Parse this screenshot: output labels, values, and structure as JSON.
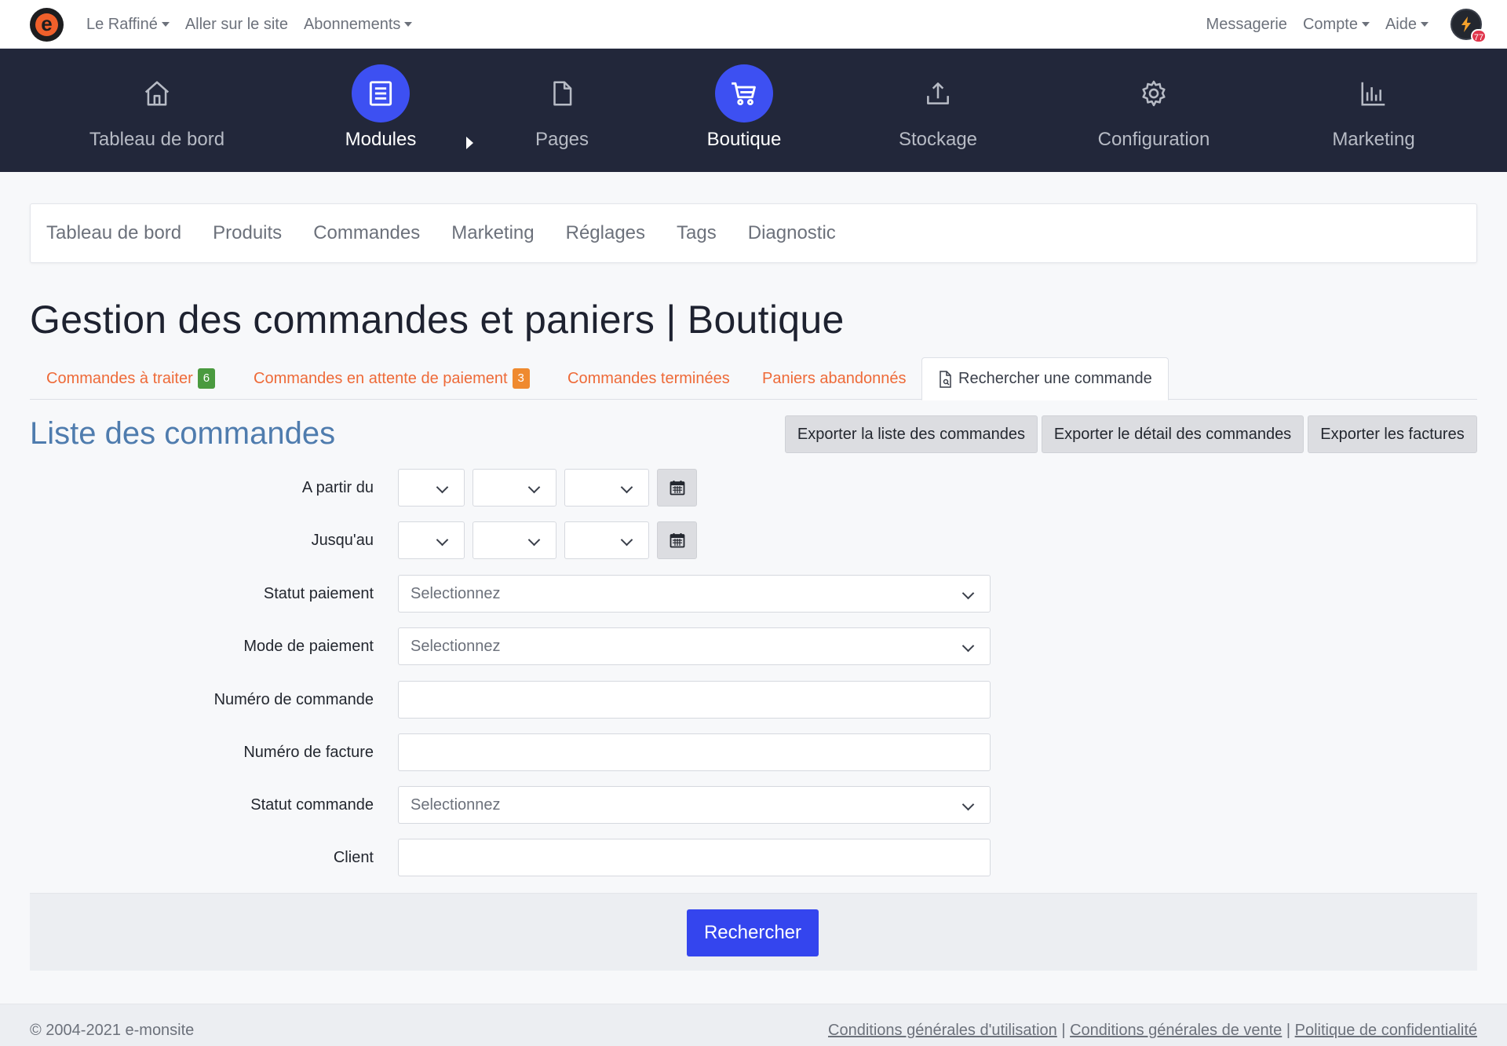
{
  "topbar": {
    "logo_letter": "e",
    "left_menu": [
      {
        "label": "Le Raffiné",
        "dropdown": true
      },
      {
        "label": "Aller sur le site",
        "dropdown": false
      },
      {
        "label": "Abonnements",
        "dropdown": true
      }
    ],
    "right_menu": [
      {
        "label": "Messagerie",
        "dropdown": false
      },
      {
        "label": "Compte",
        "dropdown": true
      },
      {
        "label": "Aide",
        "dropdown": true
      }
    ],
    "notification_count": "77"
  },
  "main_nav": [
    {
      "label": "Tableau de bord",
      "icon": "home-icon",
      "active": false
    },
    {
      "label": "Modules",
      "icon": "list-icon",
      "active": true
    },
    {
      "label": "Pages",
      "icon": "file-icon",
      "active": false
    },
    {
      "label": "Boutique",
      "icon": "cart-icon",
      "active": true
    },
    {
      "label": "Stockage",
      "icon": "upload-icon",
      "active": false
    },
    {
      "label": "Configuration",
      "icon": "gear-icon",
      "active": false
    },
    {
      "label": "Marketing",
      "icon": "bar-chart-icon",
      "active": false
    }
  ],
  "sub_nav": [
    "Tableau de bord",
    "Produits",
    "Commandes",
    "Marketing",
    "Réglages",
    "Tags",
    "Diagnostic"
  ],
  "page_title": "Gestion des commandes et paniers | Boutique",
  "tabs": [
    {
      "label": "Commandes à traiter",
      "count": "6",
      "count_color": "#4a9a3f"
    },
    {
      "label": "Commandes en attente de paiement",
      "count": "3",
      "count_color": "#ef8a2f"
    },
    {
      "label": "Commandes terminées"
    },
    {
      "label": "Paniers abandonnés"
    },
    {
      "label": "Rechercher une commande",
      "active": true
    }
  ],
  "section_title": "Liste des commandes",
  "export_buttons": [
    "Exporter la liste des commandes",
    "Exporter le détail des commandes",
    "Exporter les factures"
  ],
  "form": {
    "from_label": "A partir du",
    "to_label": "Jusqu'au",
    "payment_status_label": "Statut paiement",
    "payment_mode_label": "Mode de paiement",
    "order_number_label": "Numéro de commande",
    "invoice_number_label": "Numéro de facture",
    "order_status_label": "Statut commande",
    "client_label": "Client",
    "select_placeholder": "Selectionnez",
    "submit_label": "Rechercher"
  },
  "footer": {
    "copyright": "© 2004-2021 e-monsite",
    "links": [
      "Conditions générales d'utilisation",
      "Conditions générales de vente",
      "Politique de confidentialité"
    ],
    "separator": " | "
  },
  "colors": {
    "nav_bg": "#22273a",
    "accent_blue": "#3d50f2",
    "tab_orange": "#ee6a38",
    "section_blue": "#4f7cae"
  }
}
